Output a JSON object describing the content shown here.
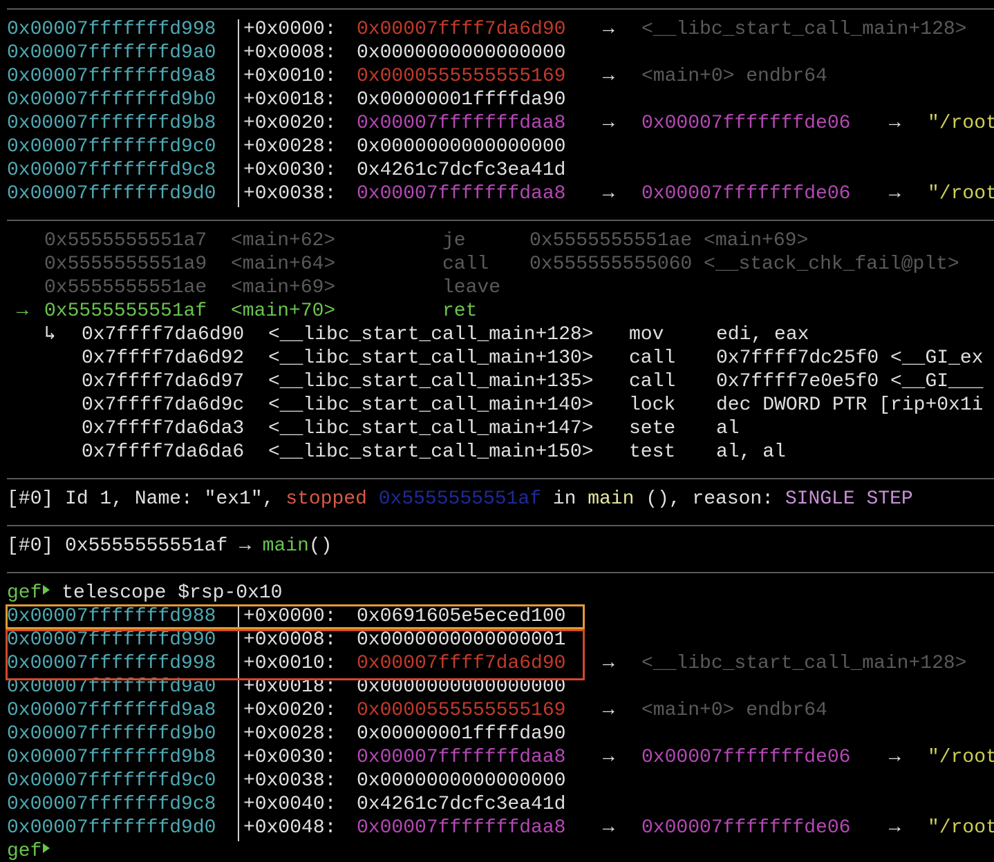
{
  "colors": {
    "address": "#4fa9b3",
    "heap_pointer": "#c23a2a",
    "stack_pointer": "#b448b4",
    "string": "#cfcf55",
    "disabled": "#5a5a5a",
    "current": "#6ac44e",
    "highlight_orange": "#e39a34",
    "highlight_red": "#d2492a"
  },
  "stack_top": [
    {
      "addr": "0x00007fffffffd998",
      "offset": "+0x0000:",
      "value": "0x00007ffff7da6d90",
      "value_color": "red",
      "arrow1": "→",
      "target": "<__libc_start_call_main+128>",
      "target_color": "gray",
      "arrow2": "",
      "string": ""
    },
    {
      "addr": "0x00007fffffffd9a0",
      "offset": "+0x0008:",
      "value": "0x0000000000000000",
      "value_color": "white",
      "arrow1": "",
      "target": "",
      "target_color": "",
      "arrow2": "",
      "string": ""
    },
    {
      "addr": "0x00007fffffffd9a8",
      "offset": "+0x0010:",
      "value": "0x0000555555555169",
      "value_color": "red",
      "arrow1": "→",
      "target": "<main+0> endbr64",
      "target_color": "gray",
      "arrow2": "",
      "string": ""
    },
    {
      "addr": "0x00007fffffffd9b0",
      "offset": "+0x0018:",
      "value": "0x00000001ffffda90",
      "value_color": "white",
      "arrow1": "",
      "target": "",
      "target_color": "",
      "arrow2": "",
      "string": ""
    },
    {
      "addr": "0x00007fffffffd9b8",
      "offset": "+0x0020:",
      "value": "0x00007fffffffdaa8",
      "value_color": "magenta",
      "arrow1": "→",
      "target": "0x00007fffffffde06",
      "target_color": "magenta",
      "arrow2": "→",
      "string": "\"/root"
    },
    {
      "addr": "0x00007fffffffd9c0",
      "offset": "+0x0028:",
      "value": "0x0000000000000000",
      "value_color": "white",
      "arrow1": "",
      "target": "",
      "target_color": "",
      "arrow2": "",
      "string": ""
    },
    {
      "addr": "0x00007fffffffd9c8",
      "offset": "+0x0030:",
      "value": "0x4261c7dcfc3ea41d",
      "value_color": "white",
      "arrow1": "",
      "target": "",
      "target_color": "",
      "arrow2": "",
      "string": ""
    },
    {
      "addr": "0x00007fffffffd9d0",
      "offset": "+0x0038:",
      "value": "0x00007fffffffdaa8",
      "value_color": "magenta",
      "arrow1": "→",
      "target": "0x00007fffffffde06",
      "target_color": "magenta",
      "arrow2": "→",
      "string": "\"/root"
    }
  ],
  "code": {
    "past": [
      {
        "addr": "0x5555555551a7",
        "sym": "<main+62>",
        "mnem": "je",
        "ops": "0x5555555551ae <main+69>"
      },
      {
        "addr": "0x5555555551a9",
        "sym": "<main+64>",
        "mnem": "call",
        "ops": "0x555555555060 <__stack_chk_fail@plt>"
      },
      {
        "addr": "0x5555555551ae",
        "sym": "<main+69>",
        "mnem": "leave",
        "ops": ""
      }
    ],
    "current": {
      "marker": "→",
      "addr": "0x5555555551af",
      "sym": "<main+70>",
      "mnem": "ret",
      "ops": ""
    },
    "ret_marker": "↳",
    "next": [
      {
        "addr": "0x7ffff7da6d90",
        "sym": "<__libc_start_call_main+128>",
        "mnem": "mov",
        "ops": "edi, eax"
      },
      {
        "addr": "0x7ffff7da6d92",
        "sym": "<__libc_start_call_main+130>",
        "mnem": "call",
        "ops": "0x7ffff7dc25f0 <__GI_ex"
      },
      {
        "addr": "0x7ffff7da6d97",
        "sym": "<__libc_start_call_main+135>",
        "mnem": "call",
        "ops": "0x7ffff7e0e5f0 <__GI___"
      },
      {
        "addr": "0x7ffff7da6d9c",
        "sym": "<__libc_start_call_main+140>",
        "mnem": "lock",
        "ops": "dec DWORD PTR [rip+0x1i"
      },
      {
        "addr": "0x7ffff7da6da3",
        "sym": "<__libc_start_call_main+147>",
        "mnem": "sete",
        "ops": "al"
      },
      {
        "addr": "0x7ffff7da6da6",
        "sym": "<__libc_start_call_main+150>",
        "mnem": "test",
        "ops": "al, al"
      }
    ]
  },
  "threads": {
    "id_tag": "[#0]",
    "text1": " Id 1, Name: \"ex1\", ",
    "state": "stopped",
    "space1": " ",
    "addr": "0x5555555551af",
    "in_word": " in ",
    "func": "main",
    "rest": " (), reason: ",
    "reason": "SINGLE STEP"
  },
  "trace": {
    "id_tag": "[#0]",
    "addr": " 0x5555555551af → ",
    "func": "main",
    "parens": "()"
  },
  "prompt": {
    "name": "gef",
    "command": " telescope $rsp-0x10"
  },
  "telescope": [
    {
      "addr": "0x00007fffffffd988",
      "offset": "+0x0000:",
      "value": "0x0691605e5eced100",
      "value_color": "white",
      "arrow1": "",
      "target": "",
      "target_color": "",
      "arrow2": "",
      "string": ""
    },
    {
      "addr": "0x00007fffffffd990",
      "offset": "+0x0008:",
      "value": "0x0000000000000001",
      "value_color": "white",
      "arrow1": "",
      "target": "",
      "target_color": "",
      "arrow2": "",
      "string": ""
    },
    {
      "addr": "0x00007fffffffd998",
      "offset": "+0x0010:",
      "value": "0x00007ffff7da6d90",
      "value_color": "red",
      "arrow1": "→",
      "target": "<__libc_start_call_main+128>",
      "target_color": "gray",
      "arrow2": "",
      "string": ""
    },
    {
      "addr": "0x00007fffffffd9a0",
      "offset": "+0x0018:",
      "value": "0x0000000000000000",
      "value_color": "white",
      "arrow1": "",
      "target": "",
      "target_color": "",
      "arrow2": "",
      "string": ""
    },
    {
      "addr": "0x00007fffffffd9a8",
      "offset": "+0x0020:",
      "value": "0x0000555555555169",
      "value_color": "red",
      "arrow1": "→",
      "target": "<main+0> endbr64",
      "target_color": "gray",
      "arrow2": "",
      "string": ""
    },
    {
      "addr": "0x00007fffffffd9b0",
      "offset": "+0x0028:",
      "value": "0x00000001ffffda90",
      "value_color": "white",
      "arrow1": "",
      "target": "",
      "target_color": "",
      "arrow2": "",
      "string": ""
    },
    {
      "addr": "0x00007fffffffd9b8",
      "offset": "+0x0030:",
      "value": "0x00007fffffffdaa8",
      "value_color": "magenta",
      "arrow1": "→",
      "target": "0x00007fffffffde06",
      "target_color": "magenta",
      "arrow2": "→",
      "string": "\"/root"
    },
    {
      "addr": "0x00007fffffffd9c0",
      "offset": "+0x0038:",
      "value": "0x0000000000000000",
      "value_color": "white",
      "arrow1": "",
      "target": "",
      "target_color": "",
      "arrow2": "",
      "string": ""
    },
    {
      "addr": "0x00007fffffffd9c8",
      "offset": "+0x0040:",
      "value": "0x4261c7dcfc3ea41d",
      "value_color": "white",
      "arrow1": "",
      "target": "",
      "target_color": "",
      "arrow2": "",
      "string": ""
    },
    {
      "addr": "0x00007fffffffd9d0",
      "offset": "+0x0048:",
      "value": "0x00007fffffffdaa8",
      "value_color": "magenta",
      "arrow1": "→",
      "target": "0x00007fffffffde06",
      "target_color": "magenta",
      "arrow2": "→",
      "string": "\"/root"
    }
  ],
  "final_prompt": {
    "name": "gef"
  }
}
